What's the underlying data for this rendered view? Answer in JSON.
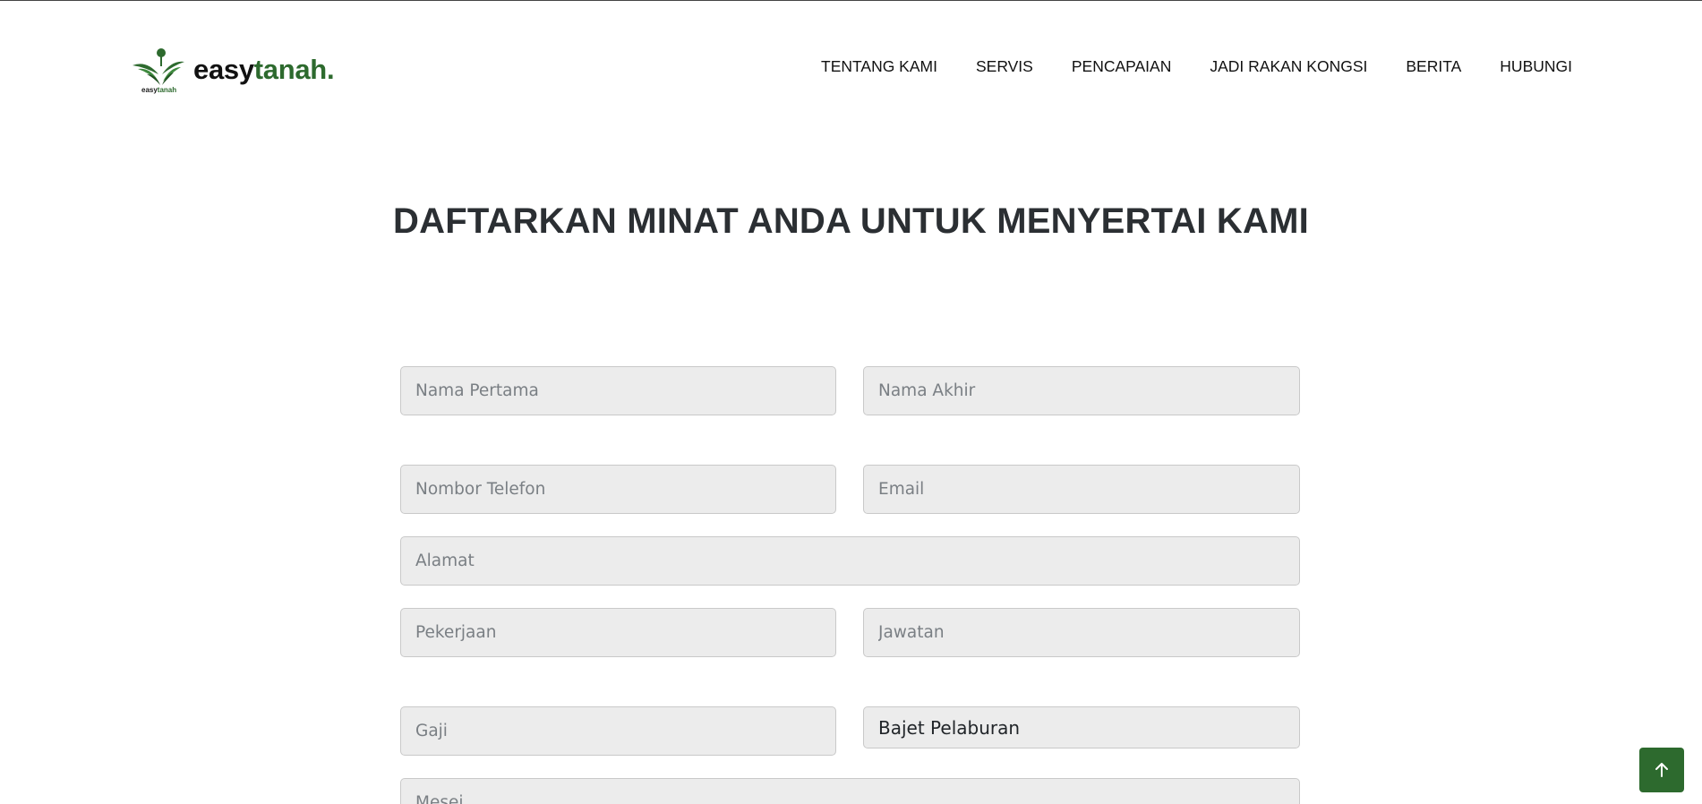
{
  "brand": {
    "logo_small_prefix": "easy",
    "logo_small_suffix": "tanah",
    "name_prefix": "easy",
    "name_suffix": "tanah.",
    "accent_color": "#2d6a2e"
  },
  "nav": {
    "items": [
      {
        "label": "TENTANG KAMI"
      },
      {
        "label": "SERVIS"
      },
      {
        "label": "PENCAPAIAN"
      },
      {
        "label": "JADI RAKAN KONGSI"
      },
      {
        "label": "BERITA"
      },
      {
        "label": "HUBUNGI"
      }
    ]
  },
  "page": {
    "title": "DAFTARKAN MINAT ANDA UNTUK MENYERTAI KAMI"
  },
  "form": {
    "first_name": {
      "placeholder": "Nama Pertama",
      "value": ""
    },
    "last_name": {
      "placeholder": "Nama Akhir",
      "value": ""
    },
    "phone": {
      "placeholder": "Nombor Telefon",
      "value": ""
    },
    "email": {
      "placeholder": "Email",
      "value": ""
    },
    "address": {
      "placeholder": "Alamat",
      "value": ""
    },
    "occupation": {
      "placeholder": "Pekerjaan",
      "value": ""
    },
    "position": {
      "placeholder": "Jawatan",
      "value": ""
    },
    "salary": {
      "placeholder": "Gaji",
      "value": ""
    },
    "budget": {
      "selected": "Bajet Pelaburan"
    },
    "message": {
      "placeholder": "Mesej",
      "value": ""
    }
  },
  "icons": {
    "back_to_top": "arrow-up-icon"
  }
}
